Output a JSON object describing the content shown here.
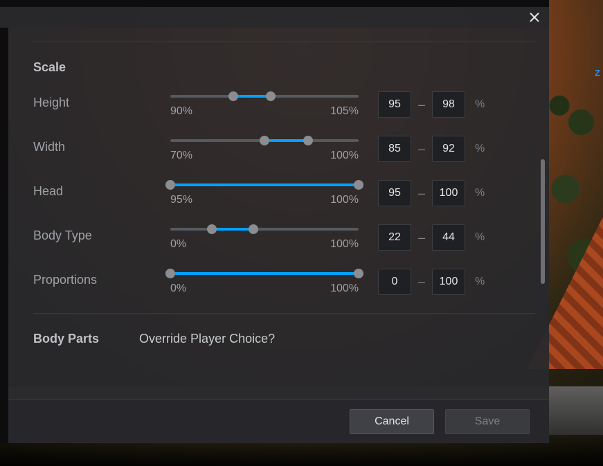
{
  "misc": {
    "z_label": "Z",
    "dash": "–",
    "percent": "%"
  },
  "scale": {
    "title": "Scale",
    "rows": [
      {
        "label": "Height",
        "minLabel": "90%",
        "maxLabel": "105%",
        "min": 90,
        "max": 105,
        "lo": 95,
        "hi": 98
      },
      {
        "label": "Width",
        "minLabel": "70%",
        "maxLabel": "100%",
        "min": 70,
        "max": 100,
        "lo": 85,
        "hi": 92
      },
      {
        "label": "Head",
        "minLabel": "95%",
        "maxLabel": "100%",
        "min": 95,
        "max": 100,
        "lo": 95,
        "hi": 100
      },
      {
        "label": "Body Type",
        "minLabel": "0%",
        "maxLabel": "100%",
        "min": 0,
        "max": 100,
        "lo": 22,
        "hi": 44
      },
      {
        "label": "Proportions",
        "minLabel": "0%",
        "maxLabel": "100%",
        "min": 0,
        "max": 100,
        "lo": 0,
        "hi": 100
      }
    ]
  },
  "bodyParts": {
    "title": "Body Parts",
    "question": "Override Player Choice?"
  },
  "footer": {
    "cancel": "Cancel",
    "save": "Save"
  }
}
